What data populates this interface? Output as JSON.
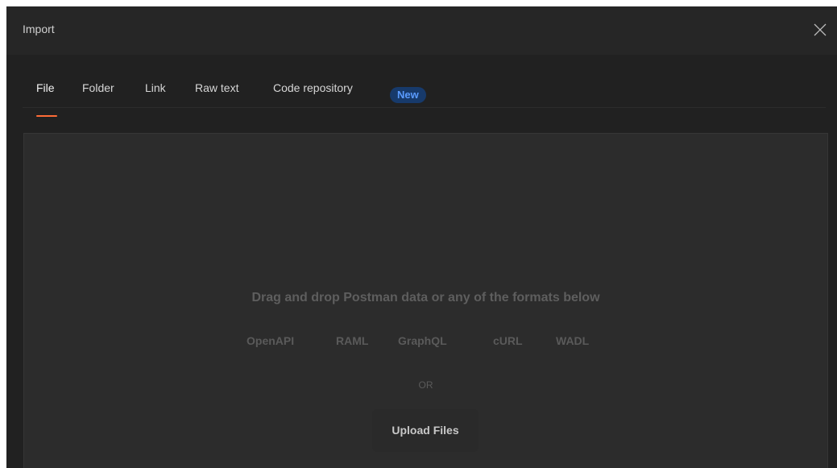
{
  "dialog": {
    "title": "Import",
    "close_icon": "close-icon"
  },
  "tabs": [
    {
      "label": "File",
      "active": true
    },
    {
      "label": "Folder",
      "active": false
    },
    {
      "label": "Link",
      "active": false
    },
    {
      "label": "Raw text",
      "active": false
    },
    {
      "label": "Code repository",
      "active": false,
      "badge": "New"
    }
  ],
  "dropzone": {
    "heading": "Drag and drop Postman data or any of the formats below",
    "formats": [
      "OpenAPI",
      "RAML",
      "GraphQL",
      "cURL",
      "WADL"
    ],
    "separator": "OR",
    "upload_label": "Upload Files"
  },
  "colors": {
    "accent": "#ff6c37",
    "badge_text": "#5a9bff",
    "badge_bg": "#173a6b",
    "background": "#212121"
  }
}
